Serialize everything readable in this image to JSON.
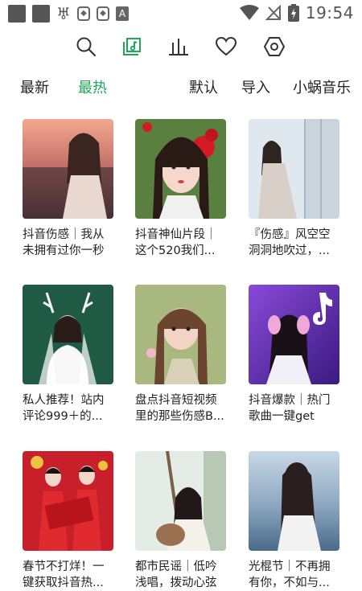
{
  "status_bar": {
    "time": "19:54"
  },
  "toolbar": {
    "icons": [
      "search-icon",
      "music-note-icon",
      "bar-chart-icon",
      "heart-icon",
      "settings-hexagon-icon"
    ],
    "accent": "#1fa65a"
  },
  "tabs": {
    "newest": "最新",
    "hottest": "最热",
    "default": "默认",
    "import": "导入",
    "snail_music": "小蜗音乐"
  },
  "playlists": [
    {
      "title": "抖音伤感｜我从未拥有过你一秒"
    },
    {
      "title": "抖音神仙片段｜这个520我们..."
    },
    {
      "title": "『伤感』风空空洞洞地吹过，..."
    },
    {
      "title": "私人推荐！站内评论999＋的..."
    },
    {
      "title": "盘点抖音短视频里的那些伤感B..."
    },
    {
      "title": "抖音爆款｜热门歌曲一键get"
    },
    {
      "title": "春节不打烊！一键获取抖音热..."
    },
    {
      "title": "都市民谣｜低吟浅唱，拨动心弦"
    },
    {
      "title": "光棍节｜不再拥有你，不如与..."
    }
  ]
}
